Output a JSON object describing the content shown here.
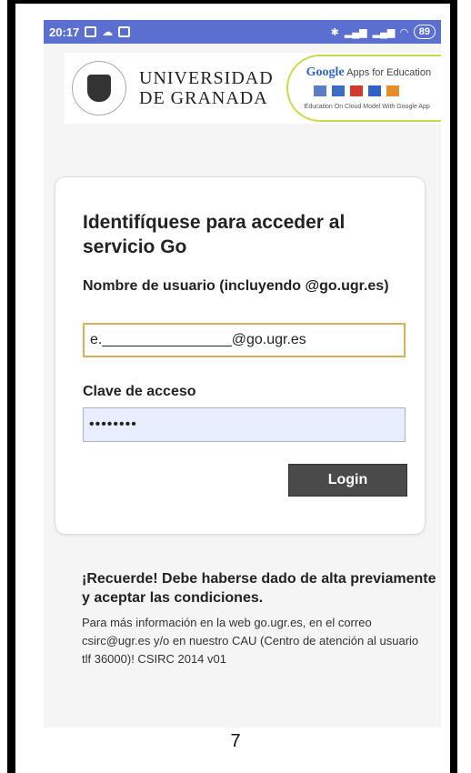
{
  "status_bar": {
    "time": "20:17",
    "battery": "89"
  },
  "header": {
    "university_line1": "UNIVERSIDAD",
    "university_line2": "DE GRANADA",
    "google_brand": "Google",
    "google_apps_text": "Apps for Education",
    "google_subtitle": "Education On Cloud Model With Google App"
  },
  "login_form": {
    "title": "Identifíquese para acceder al servicio Go",
    "username_label": "Nombre de usuario (incluyendo @go.ugr.es)",
    "username_value": "e.________________@go.ugr.es",
    "password_label": "Clave de acceso",
    "password_value": "••••••••",
    "login_button": "Login"
  },
  "notice": {
    "title": "¡Recuerde! Debe haberse dado de alta previamente y aceptar las condiciones.",
    "text": "Para más información en la web go.ugr.es, en el correo csirc@ugr.es y/o en nuestro CAU (Centro de atención al usuario tlf 36000)! CSIRC 2014 v01"
  },
  "page_number": "7",
  "colors": {
    "status_bar": "#5a6fd0",
    "login_button": "#4a4a4a",
    "username_border": "#d6b15a",
    "password_bg": "#e8eefe"
  }
}
